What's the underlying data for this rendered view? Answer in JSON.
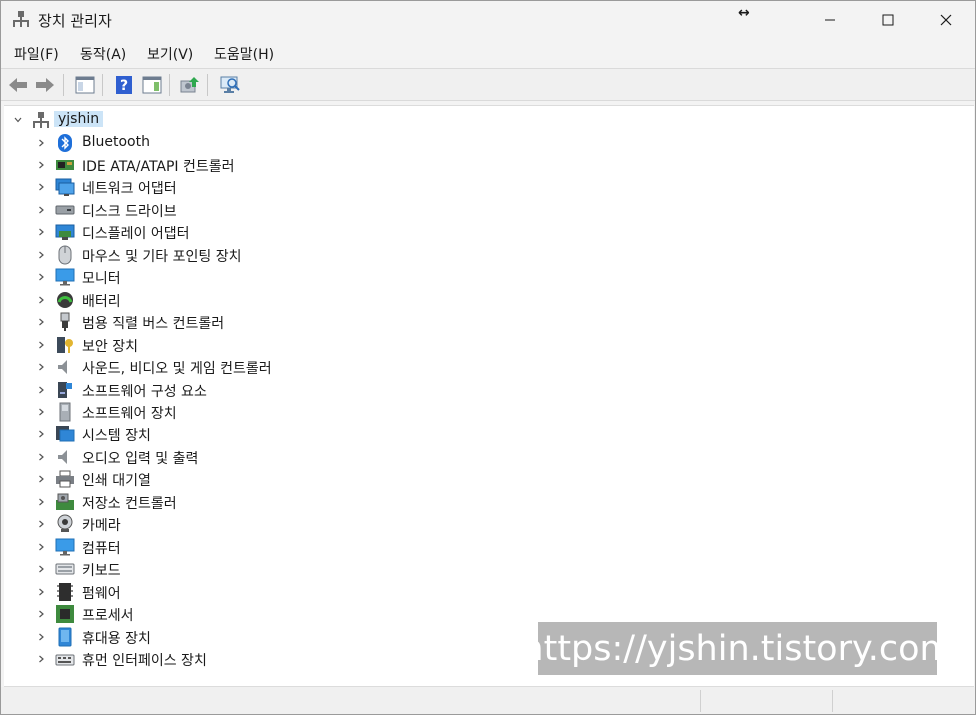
{
  "window": {
    "title": "장치 관리자",
    "resize_glyph": "↔",
    "controls": [
      "minimize",
      "maximize",
      "close"
    ]
  },
  "menu": [
    {
      "label": "파일(F)"
    },
    {
      "label": "동작(A)"
    },
    {
      "label": "보기(V)"
    },
    {
      "label": "도움말(H)"
    }
  ],
  "toolbar": {
    "buttons": [
      "back-icon",
      "forward-icon",
      "show-hide-console-tree-icon",
      "help-icon",
      "show-action-pane-icon",
      "update-driver-icon",
      "scan-hardware-icon"
    ]
  },
  "tree": {
    "root": "yjshin",
    "items": [
      {
        "label": "Bluetooth",
        "icon": "bluetooth-icon"
      },
      {
        "label": "IDE ATA/ATAPI 컨트롤러",
        "icon": "ide-controller-icon"
      },
      {
        "label": "네트워크 어댑터",
        "icon": "network-adapter-icon"
      },
      {
        "label": "디스크 드라이브",
        "icon": "disk-drive-icon"
      },
      {
        "label": "디스플레이 어댑터",
        "icon": "display-adapter-icon"
      },
      {
        "label": "마우스 및 기타 포인팅 장치",
        "icon": "mouse-icon"
      },
      {
        "label": "모니터",
        "icon": "monitor-icon"
      },
      {
        "label": "배터리",
        "icon": "battery-icon"
      },
      {
        "label": "범용 직렬 버스 컨트롤러",
        "icon": "usb-icon"
      },
      {
        "label": "보안 장치",
        "icon": "security-device-icon"
      },
      {
        "label": "사운드, 비디오 및 게임 컨트롤러",
        "icon": "sound-icon"
      },
      {
        "label": "소프트웨어 구성 요소",
        "icon": "software-component-icon"
      },
      {
        "label": "소프트웨어 장치",
        "icon": "software-device-icon"
      },
      {
        "label": "시스템 장치",
        "icon": "system-device-icon"
      },
      {
        "label": "오디오 입력 및 출력",
        "icon": "audio-io-icon"
      },
      {
        "label": "인쇄 대기열",
        "icon": "print-queue-icon"
      },
      {
        "label": "저장소 컨트롤러",
        "icon": "storage-controller-icon"
      },
      {
        "label": "카메라",
        "icon": "camera-icon"
      },
      {
        "label": "컴퓨터",
        "icon": "computer-icon"
      },
      {
        "label": "키보드",
        "icon": "keyboard-icon"
      },
      {
        "label": "펌웨어",
        "icon": "firmware-icon"
      },
      {
        "label": "프로세서",
        "icon": "processor-icon"
      },
      {
        "label": "휴대용 장치",
        "icon": "portable-device-icon"
      },
      {
        "label": "휴먼 인터페이스 장치",
        "icon": "hid-icon"
      }
    ]
  },
  "watermark": "https://yjshin.tistory.com",
  "colors": {
    "selection": "#cce4f7",
    "window_bg": "#f3f3f3",
    "tree_bg": "#ffffff",
    "watermark_bg": "#b7b7b7"
  }
}
